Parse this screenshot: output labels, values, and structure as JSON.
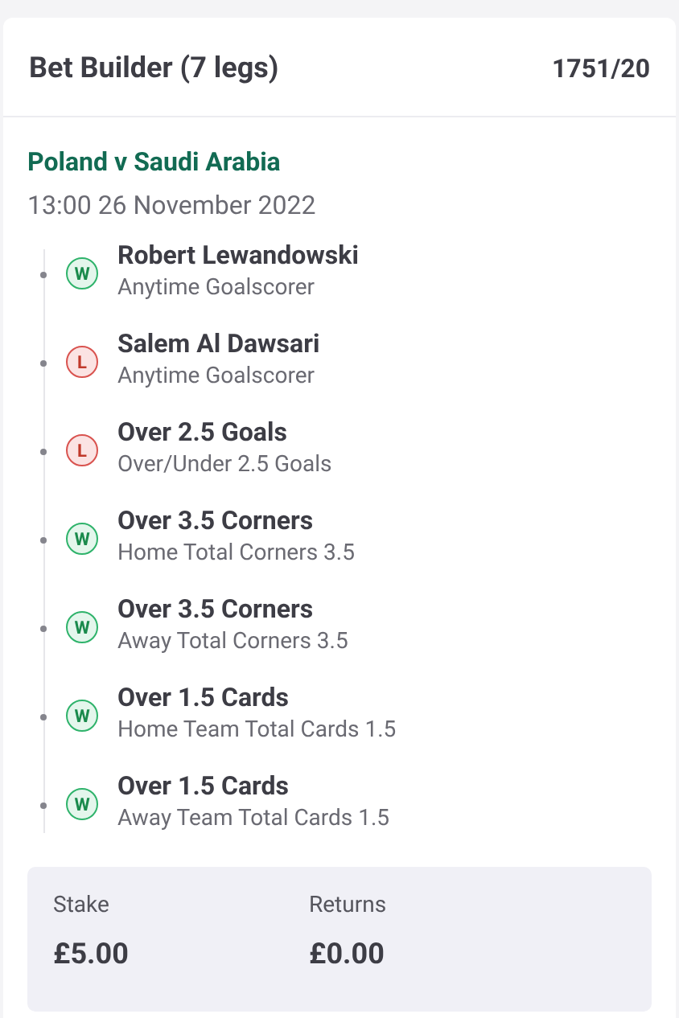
{
  "bet": {
    "title": "Bet Builder (7 legs)",
    "odds": "1751/20"
  },
  "match": {
    "name": "Poland v Saudi Arabia",
    "time": "13:00 26 November 2022"
  },
  "legs": [
    {
      "selection": "Robert Lewandowski",
      "market": "Anytime Goalscorer",
      "kind": "won",
      "badge": "W"
    },
    {
      "selection": "Salem Al Dawsari",
      "market": "Anytime Goalscorer",
      "kind": "lost",
      "badge": "L"
    },
    {
      "selection": "Over 2.5 Goals",
      "market": "Over/Under 2.5 Goals",
      "kind": "lost",
      "badge": "L"
    },
    {
      "selection": "Over 3.5 Corners",
      "market": "Home Total Corners 3.5",
      "kind": "won",
      "badge": "W"
    },
    {
      "selection": "Over 3.5 Corners",
      "market": "Away Total Corners 3.5",
      "kind": "won",
      "badge": "W"
    },
    {
      "selection": "Over 1.5 Cards",
      "market": "Home Team Total Cards 1.5",
      "kind": "won",
      "badge": "W"
    },
    {
      "selection": "Over 1.5 Cards",
      "market": "Away Team Total Cards 1.5",
      "kind": "won",
      "badge": "W"
    }
  ],
  "summary": [
    {
      "label": "Stake",
      "value": "£5.00"
    },
    {
      "label": "Returns",
      "value": "£0.00"
    }
  ]
}
